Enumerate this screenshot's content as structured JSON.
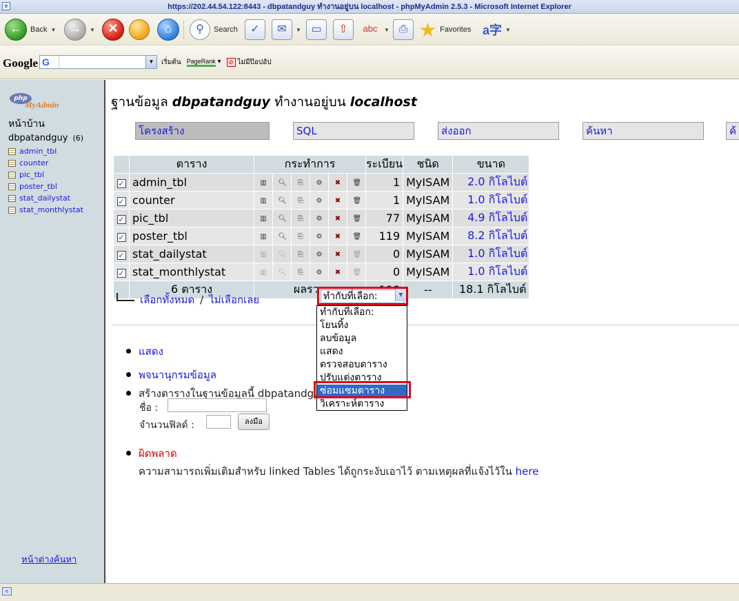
{
  "window": {
    "title": "https://202.44.54.122:8443 - dbpatandguy ทำงานอยู่บน localhost - phpMyAdmin 2.5.3 - Microsoft Internet Explorer"
  },
  "toolbar": {
    "back_label": "Back",
    "search_label": "Search",
    "favorites_label": "Favorites"
  },
  "googlebar": {
    "logo": "Google",
    "g_button": "G",
    "start_label": "เริ่มต้น",
    "pagerank_label": "PageRank",
    "popup_label": "ไม่มีป๊อปอัป"
  },
  "sidebar": {
    "home": "หน้าบ้าน",
    "db_name": "dbpatandguy",
    "db_count": "(6)",
    "tables": [
      "admin_tbl",
      "counter",
      "pic_tbl",
      "poster_tbl",
      "stat_dailystat",
      "stat_monthlystat"
    ],
    "query_window": "หน้าต่างค้นหา"
  },
  "main": {
    "heading_prefix": "ฐานข้อมูล",
    "heading_db": "dbpatandguy",
    "heading_mid": "ทำงานอยู่บน",
    "heading_host": "localhost",
    "tabs": [
      {
        "label": "โครงสร้าง",
        "active": true
      },
      {
        "label": "SQL",
        "active": false
      },
      {
        "label": "ส่งออก",
        "active": false
      },
      {
        "label": "ค้นหา",
        "active": false
      },
      {
        "label": "ค้",
        "active": false
      }
    ],
    "table_headers": {
      "table": "ตาราง",
      "action": "กระทำการ",
      "records": "ระเบียน",
      "type": "ชนิด",
      "size": "ขนาด"
    },
    "rows": [
      {
        "name": "admin_tbl",
        "records": "1",
        "type": "MyISAM",
        "size": "2.0 กิโลไบต์",
        "empty": false
      },
      {
        "name": "counter",
        "records": "1",
        "type": "MyISAM",
        "size": "1.0 กิโลไบต์",
        "empty": false
      },
      {
        "name": "pic_tbl",
        "records": "77",
        "type": "MyISAM",
        "size": "4.9 กิโลไบต์",
        "empty": false
      },
      {
        "name": "poster_tbl",
        "records": "119",
        "type": "MyISAM",
        "size": "8.2 กิโลไบต์",
        "empty": false
      },
      {
        "name": "stat_dailystat",
        "records": "0",
        "type": "MyISAM",
        "size": "1.0 กิโลไบต์",
        "empty": true
      },
      {
        "name": "stat_monthlystat",
        "records": "0",
        "type": "MyISAM",
        "size": "1.0 กิโลไบต์",
        "empty": true
      }
    ],
    "footer": {
      "tables": "6 ตาราง",
      "sum_label": "ผลรวม",
      "records": "198",
      "type": "--",
      "size": "18.1 กิโลไบต์"
    },
    "select_all": "เลือกทั้งหมด",
    "separator": "/",
    "select_none": "ไม่เลือกเลย",
    "with_selected": {
      "current": "ทำกับที่เลือก:",
      "options": [
        "ทำกับที่เลือก:",
        "โยนทิ้ง",
        "ลบข้อมูล",
        "แสดง",
        "ตรวจสอบตาราง",
        "ปรับแต่งตาราง",
        "ซ่อมแซมตาราง",
        "วิเคราะห์ตาราง"
      ],
      "highlighted_index": 6
    },
    "links": [
      "แสดง",
      "พจนานุกรมข้อมูล"
    ],
    "create": {
      "label": "สร้างตารางในฐานข้อมูลนี้ dbpatandguy",
      "name_label": "ชื่อ :",
      "fields_label": "จำนวนฟิลด์ :",
      "go": "ลงมือ"
    },
    "error": {
      "title": "ผิดพลาด",
      "message": "ความสามารถเพิ่มเติมสำหรับ linked Tables ได้ถูกระงับเอาไว้ ตามเหตุผลที่แจ้งไว้ใน",
      "link": "here"
    }
  }
}
